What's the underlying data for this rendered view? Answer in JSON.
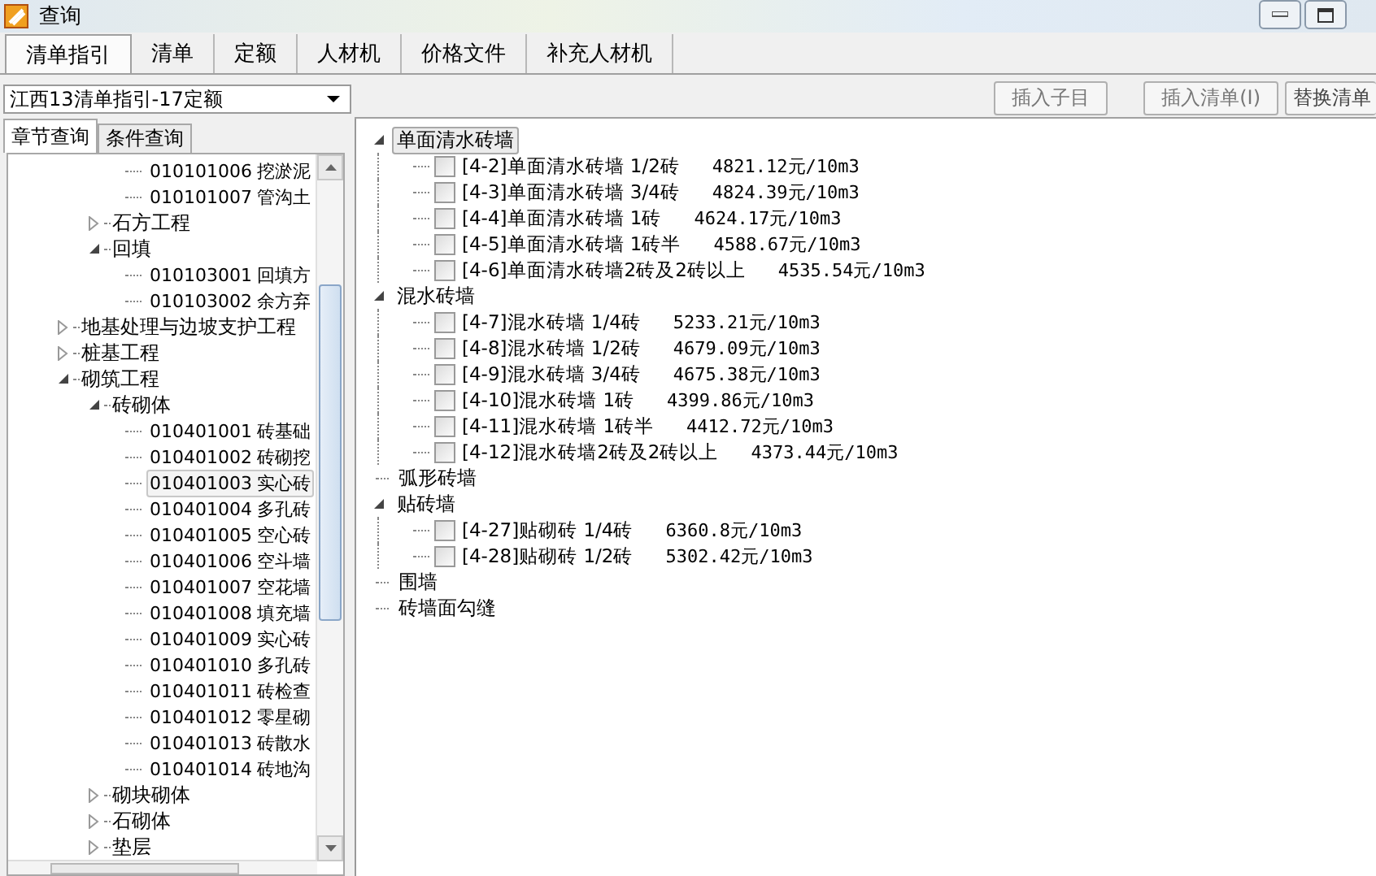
{
  "window": {
    "title": "查询"
  },
  "tabs": [
    {
      "label": "清单指引",
      "selected": true
    },
    {
      "label": "清单",
      "selected": false
    },
    {
      "label": "定额",
      "selected": false
    },
    {
      "label": "人材机",
      "selected": false
    },
    {
      "label": "价格文件",
      "selected": false
    },
    {
      "label": "补充人材机",
      "selected": false
    }
  ],
  "toolbar": {
    "buttons": [
      {
        "label": "插入子目"
      },
      {
        "label": "插入清单(I)"
      },
      {
        "label": "替换清单"
      }
    ]
  },
  "library_select": {
    "value": "江西13清单指引-17定额"
  },
  "subtabs": [
    {
      "label": "章节查询",
      "selected": true
    },
    {
      "label": "条件查询",
      "selected": false
    }
  ],
  "chapter_tree": [
    {
      "children": [
        {
          "children": [
            {
              "code": "010101006",
              "name": "挖淤泥",
              "selected": false
            },
            {
              "code": "010101007",
              "name": "管沟土",
              "selected": false
            }
          ]
        },
        {
          "label": "石方工程",
          "expanded": false
        },
        {
          "label": "回填",
          "expanded": true,
          "children": [
            {
              "code": "010103001",
              "name": "回填方",
              "selected": false
            },
            {
              "code": "010103002",
              "name": "余方弃",
              "selected": false
            }
          ]
        }
      ]
    },
    {
      "label": "地基处理与边坡支护工程",
      "expanded": false
    },
    {
      "label": "桩基工程",
      "expanded": false
    },
    {
      "label": "砌筑工程",
      "expanded": true,
      "children": [
        {
          "label": "砖砌体",
          "expanded": true,
          "children": [
            {
              "code": "010401001",
              "name": "砖基础",
              "selected": false
            },
            {
              "code": "010401002",
              "name": "砖砌挖",
              "selected": false
            },
            {
              "code": "010401003",
              "name": "实心砖",
              "selected": true
            },
            {
              "code": "010401004",
              "name": "多孔砖",
              "selected": false
            },
            {
              "code": "010401005",
              "name": "空心砖",
              "selected": false
            },
            {
              "code": "010401006",
              "name": "空斗墙",
              "selected": false
            },
            {
              "code": "010401007",
              "name": "空花墙",
              "selected": false
            },
            {
              "code": "010401008",
              "name": "填充墙",
              "selected": false
            },
            {
              "code": "010401009",
              "name": "实心砖",
              "selected": false
            },
            {
              "code": "010401010",
              "name": "多孔砖",
              "selected": false
            },
            {
              "code": "010401011",
              "name": "砖检查",
              "selected": false
            },
            {
              "code": "010401012",
              "name": "零星砌",
              "selected": false
            },
            {
              "code": "010401013",
              "name": "砖散水",
              "selected": false
            },
            {
              "code": "010401014",
              "name": "砖地沟",
              "selected": false
            }
          ]
        },
        {
          "label": "砌块砌体",
          "expanded": false
        },
        {
          "label": "石砌体",
          "expanded": false
        },
        {
          "label": "垫层",
          "expanded": false
        }
      ]
    }
  ],
  "quota_tree": [
    {
      "label": "单面清水砖墙",
      "expanded": true,
      "selected": true,
      "children": [
        {
          "label": "[4-2]单面清水砖墙 1/2砖",
          "price": "4821.12元/10m3",
          "checked": false
        },
        {
          "label": "[4-3]单面清水砖墙 3/4砖",
          "price": "4824.39元/10m3",
          "checked": false
        },
        {
          "label": "[4-4]单面清水砖墙 1砖",
          "price": "4624.17元/10m3",
          "checked": false
        },
        {
          "label": "[4-5]单面清水砖墙 1砖半",
          "price": "4588.67元/10m3",
          "checked": false
        },
        {
          "label": "[4-6]单面清水砖墙2砖及2砖以上",
          "price": "4535.54元/10m3",
          "checked": false
        }
      ]
    },
    {
      "label": "混水砖墙",
      "expanded": true,
      "selected": false,
      "children": [
        {
          "label": "[4-7]混水砖墙 1/4砖",
          "price": "5233.21元/10m3",
          "checked": false
        },
        {
          "label": "[4-8]混水砖墙 1/2砖",
          "price": "4679.09元/10m3",
          "checked": false
        },
        {
          "label": "[4-9]混水砖墙 3/4砖",
          "price": "4675.38元/10m3",
          "checked": false
        },
        {
          "label": "[4-10]混水砖墙 1砖",
          "price": "4399.86元/10m3",
          "checked": false
        },
        {
          "label": "[4-11]混水砖墙 1砖半",
          "price": "4412.72元/10m3",
          "checked": false
        },
        {
          "label": "[4-12]混水砖墙2砖及2砖以上",
          "price": "4373.44元/10m3",
          "checked": false
        }
      ]
    },
    {
      "label": "弧形砖墙"
    },
    {
      "label": "贴砖墙",
      "expanded": true,
      "selected": false,
      "children": [
        {
          "label": "[4-27]贴砌砖 1/4砖",
          "price": "6360.8元/10m3",
          "checked": false
        },
        {
          "label": "[4-28]贴砌砖 1/2砖",
          "price": "5302.42元/10m3",
          "checked": false
        }
      ]
    },
    {
      "label": "围墙"
    },
    {
      "label": "砖墙面勾缝"
    }
  ]
}
